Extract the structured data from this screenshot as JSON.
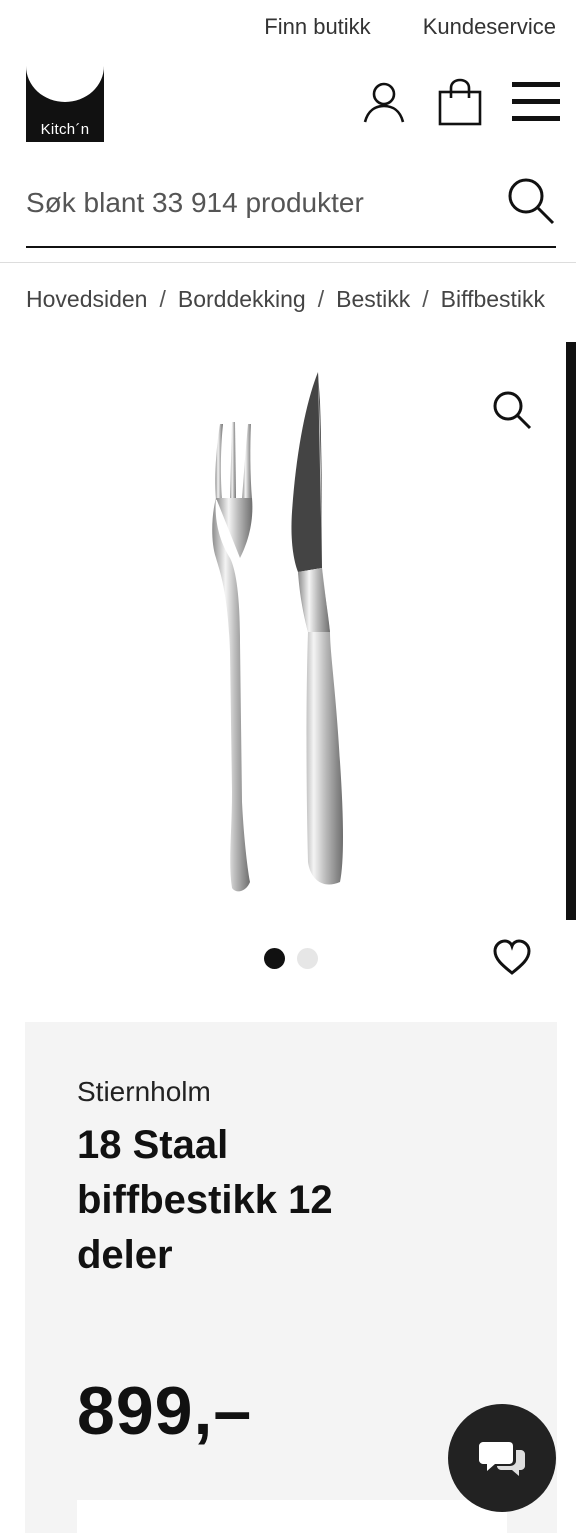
{
  "top_links": [
    "Finn butikk",
    "Kundeservice"
  ],
  "logo": {
    "text": "Kitch´n"
  },
  "header_icons": [
    "user-icon",
    "shopping-bag-icon",
    "menu-icon"
  ],
  "search": {
    "placeholder": "Søk blant 33 914 produkter"
  },
  "breadcrumb": [
    "Hovedsiden",
    "Borddekking",
    "Bestikk",
    "Biffbestikk"
  ],
  "gallery": {
    "image_count": 2,
    "active_index": 0
  },
  "product": {
    "brand": "Stiernholm",
    "title": "18 Staal biffbestikk 12 deler",
    "price": "899,–"
  },
  "colors": {
    "text": "#111111",
    "panel": "#f4f4f4",
    "chat_button": "#222222"
  }
}
